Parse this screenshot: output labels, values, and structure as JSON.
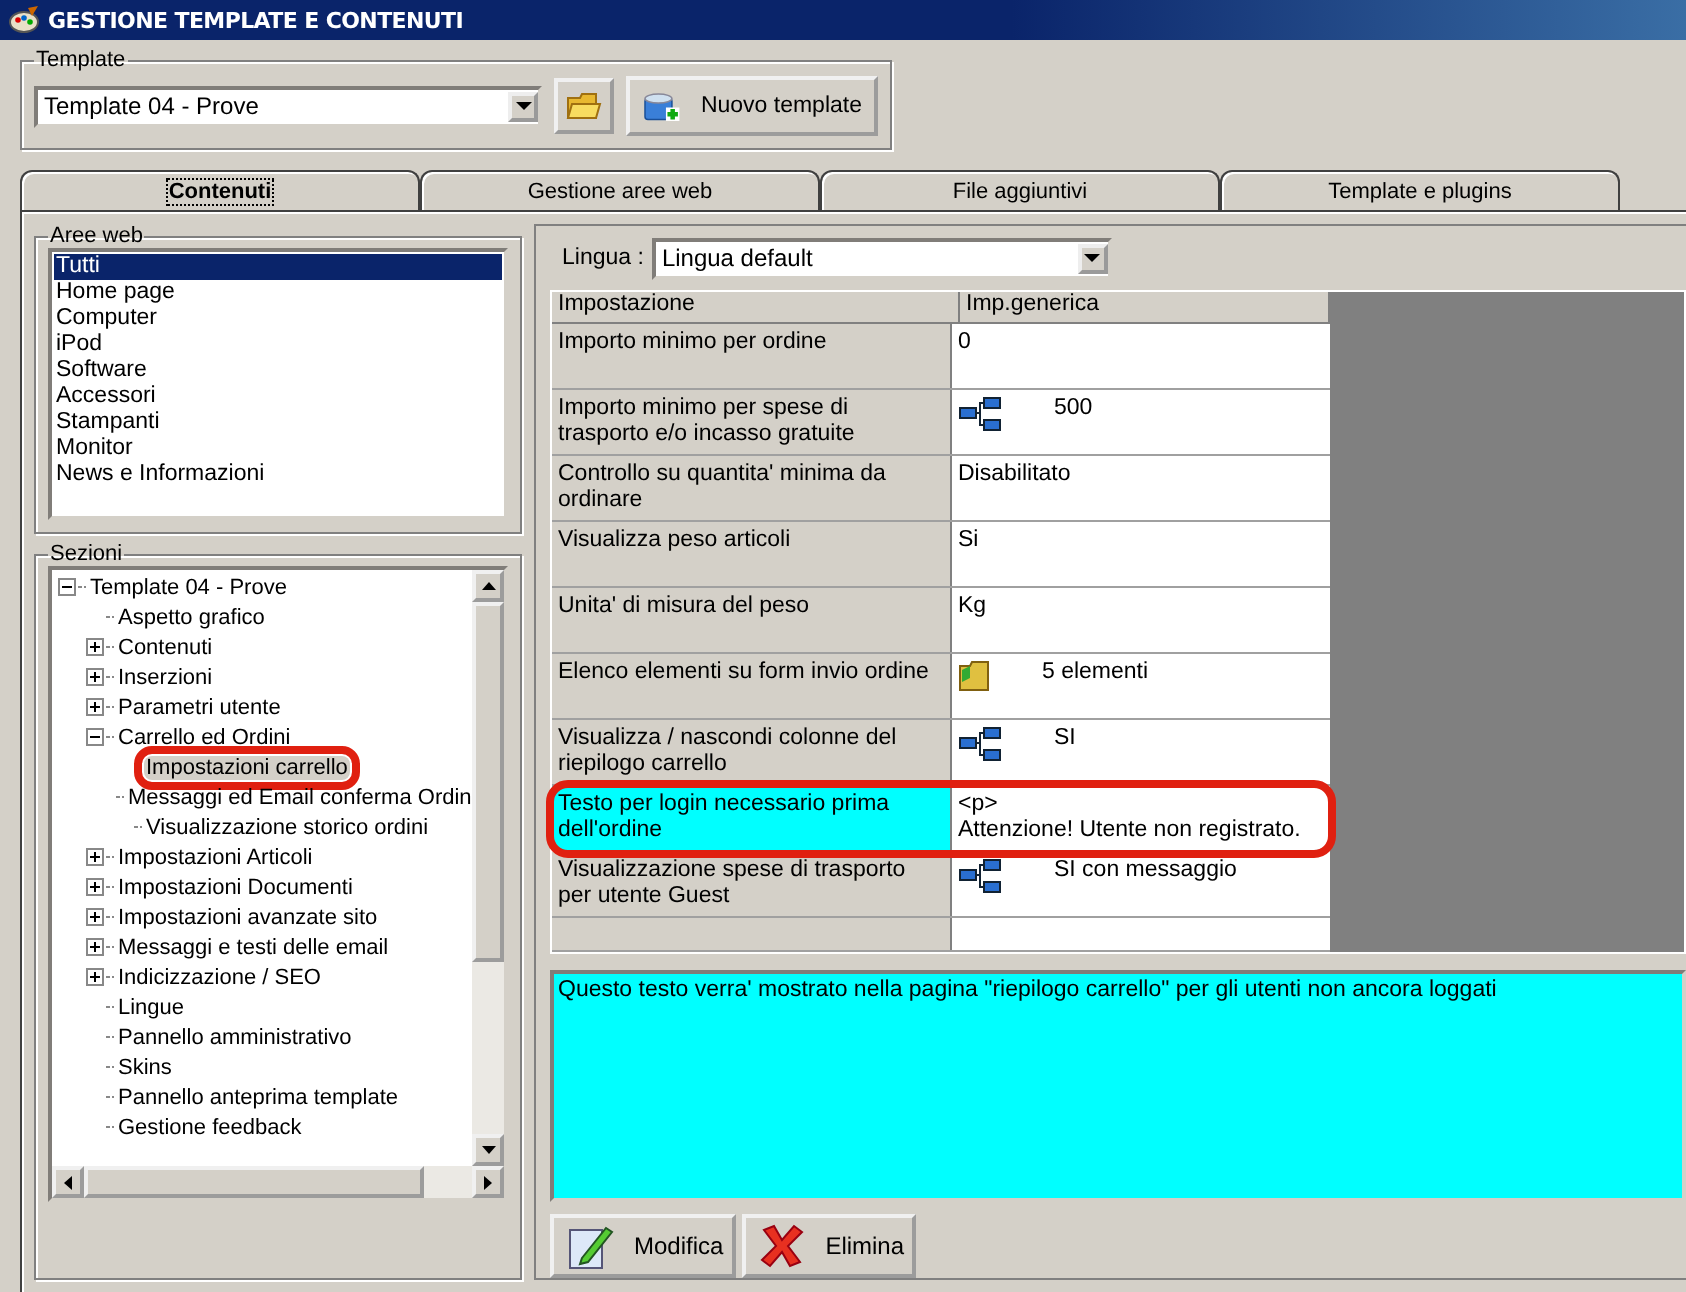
{
  "window": {
    "title": "GESTIONE TEMPLATE E CONTENUTI"
  },
  "template_group": {
    "label": "Template",
    "value": "Template 04 - Prove",
    "new_button": "Nuovo template"
  },
  "tabs": [
    {
      "label": "Contenuti",
      "selected": true
    },
    {
      "label": "Gestione aree web",
      "selected": false
    },
    {
      "label": "File aggiuntivi",
      "selected": false
    },
    {
      "label": "Template e plugins",
      "selected": false
    }
  ],
  "web_areas": {
    "label": "Aree web",
    "items": [
      {
        "label": "Tutti",
        "selected": true
      },
      {
        "label": "Home page",
        "selected": false
      },
      {
        "label": "Computer",
        "selected": false
      },
      {
        "label": "iPod",
        "selected": false
      },
      {
        "label": "Software",
        "selected": false
      },
      {
        "label": "Accessori",
        "selected": false
      },
      {
        "label": "Stampanti",
        "selected": false
      },
      {
        "label": "Monitor",
        "selected": false
      },
      {
        "label": "News e Informazioni",
        "selected": false
      }
    ]
  },
  "sections": {
    "label": "Sezioni",
    "tree": [
      {
        "label": "Template 04 - Prove",
        "expanded": true,
        "selected": false,
        "highlighted": false,
        "children": [
          {
            "label": "Aspetto grafico",
            "selected": false,
            "highlighted": false
          },
          {
            "label": "Contenuti",
            "expanded": false,
            "selected": false,
            "highlighted": false
          },
          {
            "label": "Inserzioni",
            "expanded": false,
            "selected": false,
            "highlighted": false
          },
          {
            "label": "Parametri utente",
            "expanded": false,
            "selected": false,
            "highlighted": false
          },
          {
            "label": "Carrello ed Ordini",
            "expanded": true,
            "selected": false,
            "highlighted": false,
            "children": [
              {
                "label": "Impostazioni carrello",
                "selected": true,
                "highlighted": true
              },
              {
                "label": "Messaggi ed Email conferma Ordin",
                "selected": false,
                "highlighted": false
              },
              {
                "label": "Visualizzazione storico ordini",
                "selected": false,
                "highlighted": false
              }
            ]
          },
          {
            "label": "Impostazioni Articoli",
            "expanded": false,
            "selected": false,
            "highlighted": false
          },
          {
            "label": "Impostazioni Documenti",
            "expanded": false,
            "selected": false,
            "highlighted": false
          },
          {
            "label": "Impostazioni avanzate sito",
            "expanded": false,
            "selected": false,
            "highlighted": false
          },
          {
            "label": "Messaggi e testi delle email",
            "expanded": false,
            "selected": false,
            "highlighted": false
          },
          {
            "label": "Indicizzazione / SEO",
            "expanded": false,
            "selected": false,
            "highlighted": false
          },
          {
            "label": "Lingue",
            "selected": false,
            "highlighted": false
          },
          {
            "label": "Pannello amministrativo",
            "selected": false,
            "highlighted": false
          },
          {
            "label": "Skins",
            "selected": false,
            "highlighted": false
          },
          {
            "label": "Pannello anteprima template",
            "selected": false,
            "highlighted": false
          },
          {
            "label": "Gestione feedback",
            "selected": false,
            "highlighted": false
          }
        ]
      }
    ]
  },
  "language": {
    "label": "Lingua :",
    "value": "Lingua default"
  },
  "settings_table": {
    "columns": [
      "Impostazione",
      "Imp.generica"
    ],
    "rows": [
      {
        "setting": "Importo minimo per ordine",
        "value": "0",
        "kind": "plain",
        "selected": false,
        "highlighted": false
      },
      {
        "setting": "Importo minimo per spese di trasporto e/o incasso gratuite",
        "value": "500",
        "kind": "linked",
        "selected": false,
        "highlighted": false
      },
      {
        "setting": "Controllo su quantita' minima da ordinare",
        "value": "Disabilitato",
        "kind": "plain",
        "selected": false,
        "highlighted": false
      },
      {
        "setting": "Visualizza peso articoli",
        "value": "Si",
        "kind": "plain",
        "selected": false,
        "highlighted": false
      },
      {
        "setting": "Unita' di misura del peso",
        "value": "Kg",
        "kind": "plain",
        "selected": false,
        "highlighted": false
      },
      {
        "setting": "Elenco elementi su form invio ordine",
        "value": "5 elementi",
        "kind": "list",
        "selected": false,
        "highlighted": false
      },
      {
        "setting": "Visualizza / nascondi colonne del riepilogo carrello",
        "value": "SI",
        "kind": "linked",
        "selected": false,
        "highlighted": false
      },
      {
        "setting": "Testo per login necessario prima dell'ordine",
        "value": "<p>\n  Attenzione! Utente non registrato.",
        "kind": "plain",
        "selected": true,
        "highlighted": true
      },
      {
        "setting": "Visualizzazione spese di trasporto per utente Guest",
        "value": "SI con messaggio",
        "kind": "linked",
        "selected": false,
        "highlighted": false
      }
    ]
  },
  "description": "Questo testo verra' mostrato nella pagina \"riepilogo carrello\" per gli utenti non ancora loggati",
  "buttons": [
    {
      "label": "Modifica",
      "kind": "edit"
    },
    {
      "label": "Elimina",
      "kind": "delete"
    }
  ]
}
